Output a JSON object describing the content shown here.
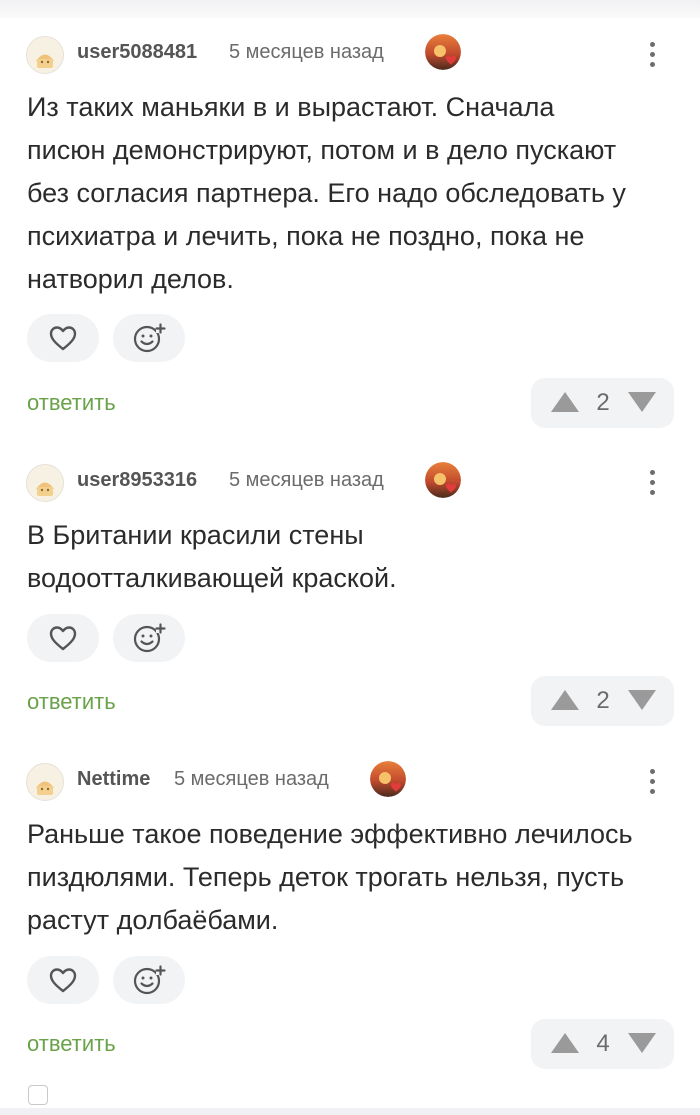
{
  "comments": [
    {
      "username": "user5088481",
      "time": "5 месяцев назад",
      "lines": [
        "Из таких маньяки в и вырастают. Сначала",
        "писюн демонстрируют, потом и в дело пускают",
        "без согласия партнера. Его надо обследовать у",
        "психиатра и лечить, пока не поздно, пока не",
        "натворил делов."
      ],
      "reply_label": "ответить",
      "votes": "2"
    },
    {
      "username": "user8953316",
      "time": "5 месяцев назад",
      "lines": [
        "В Британии красили стены",
        "водоотталкивающей краской."
      ],
      "reply_label": "ответить",
      "votes": "2"
    },
    {
      "username": "Nettime",
      "time": "5 месяцев назад",
      "lines": [
        "Раньше такое поведение эффективно лечилось",
        "пиздюлями. Теперь деток трогать нельзя, пусть",
        "растут долбаёбами."
      ],
      "reply_label": "ответить",
      "votes": "4"
    }
  ],
  "icons": {
    "avatar": "default-avatar-icon",
    "badge": "heart-badge-icon",
    "more": "more-vertical-icon",
    "like": "heart-outline-icon",
    "reaction": "add-emoji-icon",
    "vote_up": "triangle-up-icon",
    "vote_down": "triangle-down-icon"
  },
  "colors": {
    "reply": "#6aa24a",
    "pill_bg": "#f2f3f5",
    "vote_arrow": "#9a9a9a"
  }
}
